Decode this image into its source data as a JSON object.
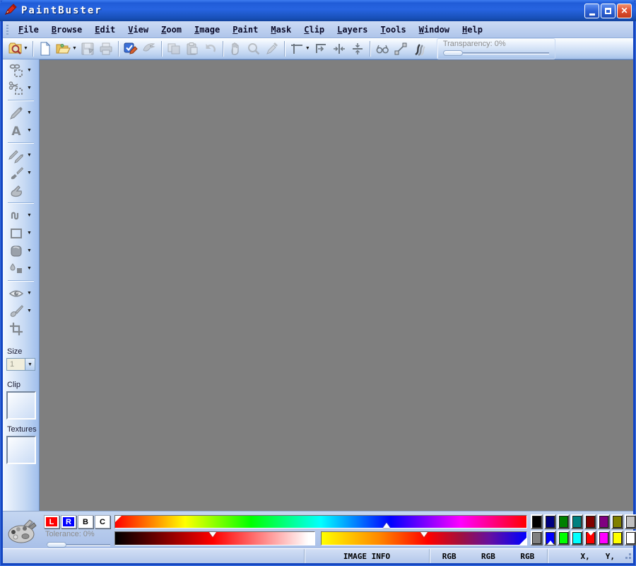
{
  "window": {
    "title": "PaintBuster"
  },
  "menu": {
    "items": [
      "File",
      "Browse",
      "Edit",
      "View",
      "Zoom",
      "Image",
      "Paint",
      "Mask",
      "Clip",
      "Layers",
      "Tools",
      "Window",
      "Help"
    ]
  },
  "toolbar": {
    "transparency_label": "Transparency: 0%",
    "buttons": [
      {
        "name": "browse",
        "icon": "browse-folder",
        "dropdown": true,
        "enabled": true
      },
      {
        "sep": true
      },
      {
        "name": "new",
        "icon": "new-document",
        "enabled": true
      },
      {
        "name": "open",
        "icon": "open-folder",
        "dropdown": true,
        "enabled": true
      },
      {
        "name": "save",
        "icon": "save",
        "enabled": false
      },
      {
        "name": "print",
        "icon": "print",
        "enabled": false
      },
      {
        "sep": true
      },
      {
        "name": "preferences",
        "icon": "check-edit",
        "enabled": true
      },
      {
        "name": "eagle",
        "icon": "eagle",
        "enabled": false
      },
      {
        "sep": true
      },
      {
        "name": "copy",
        "icon": "copy",
        "enabled": false
      },
      {
        "name": "paste",
        "icon": "paste",
        "enabled": false
      },
      {
        "name": "undo",
        "icon": "undo",
        "enabled": false
      },
      {
        "sep": true
      },
      {
        "name": "pan",
        "icon": "hand",
        "enabled": false
      },
      {
        "name": "zoom",
        "icon": "magnifier",
        "enabled": false
      },
      {
        "name": "eyedropper",
        "icon": "eyedropper",
        "enabled": false
      },
      {
        "sep": true
      },
      {
        "name": "measure",
        "icon": "t-square",
        "dropdown": true,
        "enabled": true
      },
      {
        "name": "align-left",
        "icon": "align-left",
        "enabled": true
      },
      {
        "name": "align-center-h",
        "icon": "align-center-h",
        "enabled": true
      },
      {
        "name": "align-center-v",
        "icon": "align-center-v",
        "enabled": true
      },
      {
        "sep": true
      },
      {
        "name": "preview-glasses",
        "icon": "glasses",
        "enabled": true
      },
      {
        "name": "path-node",
        "icon": "node-line",
        "enabled": true
      },
      {
        "name": "blend",
        "icon": "wave",
        "enabled": true
      }
    ]
  },
  "sidebar": {
    "tools": [
      {
        "name": "select-marquee",
        "icon": "marquee",
        "dropdown": true
      },
      {
        "name": "cut-selection",
        "icon": "cut-marquee",
        "dropdown": true
      },
      {
        "sep": true
      },
      {
        "name": "pencil",
        "icon": "pencil",
        "dropdown": true
      },
      {
        "name": "text",
        "icon": "text",
        "dropdown": true
      },
      {
        "sep": true
      },
      {
        "name": "pens",
        "icon": "pens",
        "dropdown": true
      },
      {
        "name": "brush",
        "icon": "brush",
        "dropdown": true
      },
      {
        "name": "glove",
        "icon": "fill-hand",
        "dropdown": false
      },
      {
        "sep": true
      },
      {
        "name": "curve",
        "icon": "curve",
        "dropdown": true
      },
      {
        "name": "rectangle",
        "icon": "rect",
        "dropdown": true
      },
      {
        "name": "rounded-rect",
        "icon": "round-rect",
        "dropdown": true
      },
      {
        "name": "fill",
        "icon": "fill-drop",
        "dropdown": true
      },
      {
        "sep": true
      },
      {
        "name": "red-eye",
        "icon": "eye",
        "dropdown": true
      },
      {
        "name": "smear",
        "icon": "spoon",
        "dropdown": true
      },
      {
        "name": "crop",
        "icon": "crop",
        "dropdown": false
      }
    ],
    "size_label": "Size",
    "size_value": "1",
    "clip_label": "Clip",
    "textures_label": "Textures"
  },
  "color_panel": {
    "mode_buttons": [
      {
        "label": "L",
        "bg": "#FF0000",
        "fg": "#FFFFFF"
      },
      {
        "label": "R",
        "bg": "#0000FF",
        "fg": "#FFFFFF"
      },
      {
        "label": "B",
        "bg": "#FFFFFF",
        "fg": "#000000"
      },
      {
        "label": "C",
        "bg": "#FFFFFF",
        "fg": "#000000"
      }
    ],
    "tolerance_label": "Tolerance: 0%",
    "hue_bar": {
      "stops": [
        [
          "#FF0000",
          0
        ],
        [
          "#FFFF00",
          17
        ],
        [
          "#00FF00",
          33
        ],
        [
          "#00FFFF",
          50
        ],
        [
          "#0000FF",
          67
        ],
        [
          "#FF00FF",
          84
        ],
        [
          "#FF0000",
          100
        ]
      ],
      "marker_pct": 66
    },
    "shade_bar": {
      "stops": [
        [
          "#000000",
          0
        ],
        [
          "#FF0000",
          49
        ],
        [
          "#FFFFFF",
          97
        ]
      ],
      "marker_pct": 49
    },
    "tint_bar": {
      "stops": [
        [
          "#FFFF00",
          0
        ],
        [
          "#FF8800",
          28
        ],
        [
          "#FF0000",
          52
        ],
        [
          "#A01040",
          68
        ],
        [
          "#6610A0",
          82
        ],
        [
          "#0000FF",
          100
        ]
      ],
      "marker_pct": 50
    },
    "palette": {
      "rows": [
        [
          "#000000",
          "#000080",
          "#008000",
          "#008080",
          "#800000",
          "#800080",
          "#808000",
          "#C0C0C0"
        ],
        [
          "#808080",
          "#0000FF",
          "#00FF00",
          "#00FFFF",
          "#FF0000",
          "#FF00FF",
          "#FFFF00",
          "#FFFFFF"
        ]
      ],
      "foreground_marker": {
        "row": 1,
        "col": 4
      },
      "background_marker": {
        "row": 1,
        "col": 1
      }
    }
  },
  "status_bar": {
    "image_info": "IMAGE INFO",
    "rgb_labels": [
      "RGB",
      "RGB",
      "RGB"
    ],
    "x_label": "X,",
    "y_label": "Y,"
  }
}
